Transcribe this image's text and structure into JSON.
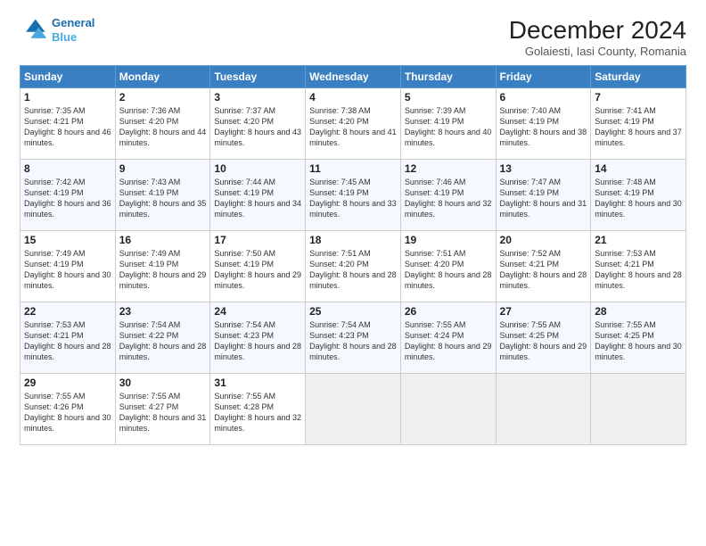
{
  "header": {
    "logo_line1": "General",
    "logo_line2": "Blue",
    "month_title": "December 2024",
    "location": "Golaiesti, Iasi County, Romania"
  },
  "days_of_week": [
    "Sunday",
    "Monday",
    "Tuesday",
    "Wednesday",
    "Thursday",
    "Friday",
    "Saturday"
  ],
  "weeks": [
    [
      {
        "day": "1",
        "sunrise": "Sunrise: 7:35 AM",
        "sunset": "Sunset: 4:21 PM",
        "daylight": "Daylight: 8 hours and 46 minutes."
      },
      {
        "day": "2",
        "sunrise": "Sunrise: 7:36 AM",
        "sunset": "Sunset: 4:20 PM",
        "daylight": "Daylight: 8 hours and 44 minutes."
      },
      {
        "day": "3",
        "sunrise": "Sunrise: 7:37 AM",
        "sunset": "Sunset: 4:20 PM",
        "daylight": "Daylight: 8 hours and 43 minutes."
      },
      {
        "day": "4",
        "sunrise": "Sunrise: 7:38 AM",
        "sunset": "Sunset: 4:20 PM",
        "daylight": "Daylight: 8 hours and 41 minutes."
      },
      {
        "day": "5",
        "sunrise": "Sunrise: 7:39 AM",
        "sunset": "Sunset: 4:19 PM",
        "daylight": "Daylight: 8 hours and 40 minutes."
      },
      {
        "day": "6",
        "sunrise": "Sunrise: 7:40 AM",
        "sunset": "Sunset: 4:19 PM",
        "daylight": "Daylight: 8 hours and 38 minutes."
      },
      {
        "day": "7",
        "sunrise": "Sunrise: 7:41 AM",
        "sunset": "Sunset: 4:19 PM",
        "daylight": "Daylight: 8 hours and 37 minutes."
      }
    ],
    [
      {
        "day": "8",
        "sunrise": "Sunrise: 7:42 AM",
        "sunset": "Sunset: 4:19 PM",
        "daylight": "Daylight: 8 hours and 36 minutes."
      },
      {
        "day": "9",
        "sunrise": "Sunrise: 7:43 AM",
        "sunset": "Sunset: 4:19 PM",
        "daylight": "Daylight: 8 hours and 35 minutes."
      },
      {
        "day": "10",
        "sunrise": "Sunrise: 7:44 AM",
        "sunset": "Sunset: 4:19 PM",
        "daylight": "Daylight: 8 hours and 34 minutes."
      },
      {
        "day": "11",
        "sunrise": "Sunrise: 7:45 AM",
        "sunset": "Sunset: 4:19 PM",
        "daylight": "Daylight: 8 hours and 33 minutes."
      },
      {
        "day": "12",
        "sunrise": "Sunrise: 7:46 AM",
        "sunset": "Sunset: 4:19 PM",
        "daylight": "Daylight: 8 hours and 32 minutes."
      },
      {
        "day": "13",
        "sunrise": "Sunrise: 7:47 AM",
        "sunset": "Sunset: 4:19 PM",
        "daylight": "Daylight: 8 hours and 31 minutes."
      },
      {
        "day": "14",
        "sunrise": "Sunrise: 7:48 AM",
        "sunset": "Sunset: 4:19 PM",
        "daylight": "Daylight: 8 hours and 30 minutes."
      }
    ],
    [
      {
        "day": "15",
        "sunrise": "Sunrise: 7:49 AM",
        "sunset": "Sunset: 4:19 PM",
        "daylight": "Daylight: 8 hours and 30 minutes."
      },
      {
        "day": "16",
        "sunrise": "Sunrise: 7:49 AM",
        "sunset": "Sunset: 4:19 PM",
        "daylight": "Daylight: 8 hours and 29 minutes."
      },
      {
        "day": "17",
        "sunrise": "Sunrise: 7:50 AM",
        "sunset": "Sunset: 4:19 PM",
        "daylight": "Daylight: 8 hours and 29 minutes."
      },
      {
        "day": "18",
        "sunrise": "Sunrise: 7:51 AM",
        "sunset": "Sunset: 4:20 PM",
        "daylight": "Daylight: 8 hours and 28 minutes."
      },
      {
        "day": "19",
        "sunrise": "Sunrise: 7:51 AM",
        "sunset": "Sunset: 4:20 PM",
        "daylight": "Daylight: 8 hours and 28 minutes."
      },
      {
        "day": "20",
        "sunrise": "Sunrise: 7:52 AM",
        "sunset": "Sunset: 4:21 PM",
        "daylight": "Daylight: 8 hours and 28 minutes."
      },
      {
        "day": "21",
        "sunrise": "Sunrise: 7:53 AM",
        "sunset": "Sunset: 4:21 PM",
        "daylight": "Daylight: 8 hours and 28 minutes."
      }
    ],
    [
      {
        "day": "22",
        "sunrise": "Sunrise: 7:53 AM",
        "sunset": "Sunset: 4:21 PM",
        "daylight": "Daylight: 8 hours and 28 minutes."
      },
      {
        "day": "23",
        "sunrise": "Sunrise: 7:54 AM",
        "sunset": "Sunset: 4:22 PM",
        "daylight": "Daylight: 8 hours and 28 minutes."
      },
      {
        "day": "24",
        "sunrise": "Sunrise: 7:54 AM",
        "sunset": "Sunset: 4:23 PM",
        "daylight": "Daylight: 8 hours and 28 minutes."
      },
      {
        "day": "25",
        "sunrise": "Sunrise: 7:54 AM",
        "sunset": "Sunset: 4:23 PM",
        "daylight": "Daylight: 8 hours and 28 minutes."
      },
      {
        "day": "26",
        "sunrise": "Sunrise: 7:55 AM",
        "sunset": "Sunset: 4:24 PM",
        "daylight": "Daylight: 8 hours and 29 minutes."
      },
      {
        "day": "27",
        "sunrise": "Sunrise: 7:55 AM",
        "sunset": "Sunset: 4:25 PM",
        "daylight": "Daylight: 8 hours and 29 minutes."
      },
      {
        "day": "28",
        "sunrise": "Sunrise: 7:55 AM",
        "sunset": "Sunset: 4:25 PM",
        "daylight": "Daylight: 8 hours and 30 minutes."
      }
    ],
    [
      {
        "day": "29",
        "sunrise": "Sunrise: 7:55 AM",
        "sunset": "Sunset: 4:26 PM",
        "daylight": "Daylight: 8 hours and 30 minutes."
      },
      {
        "day": "30",
        "sunrise": "Sunrise: 7:55 AM",
        "sunset": "Sunset: 4:27 PM",
        "daylight": "Daylight: 8 hours and 31 minutes."
      },
      {
        "day": "31",
        "sunrise": "Sunrise: 7:55 AM",
        "sunset": "Sunset: 4:28 PM",
        "daylight": "Daylight: 8 hours and 32 minutes."
      },
      null,
      null,
      null,
      null
    ]
  ]
}
